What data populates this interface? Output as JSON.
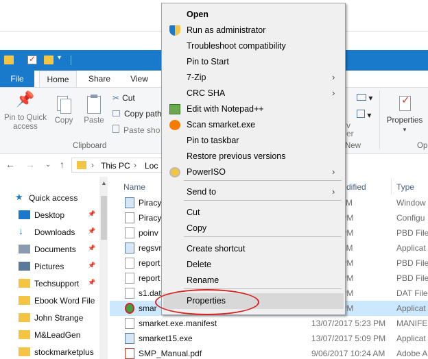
{
  "ribbon": {
    "tabs": {
      "file": "File",
      "home": "Home",
      "share": "Share",
      "view": "View"
    },
    "clipboard": {
      "pin_quick_access": "Pin to Quick access",
      "copy": "Copy",
      "paste": "Paste",
      "cut": "Cut",
      "copy_path": "Copy path",
      "paste_shortcut": "Paste sho",
      "group_label": "Clipboard"
    },
    "right": {
      "v": "v",
      "er": "er",
      "new_group": "New",
      "properties": "Properties",
      "op": "Op"
    }
  },
  "address": {
    "this_pc": "This PC",
    "loc": "Loc",
    "separator": "›"
  },
  "nav_pane": {
    "quick_access": "Quick access",
    "items": [
      {
        "label": "Desktop",
        "icon": "desktop-icon",
        "pinned": true
      },
      {
        "label": "Downloads",
        "icon": "downloads-icon",
        "pinned": true
      },
      {
        "label": "Documents",
        "icon": "documents-icon",
        "pinned": true
      },
      {
        "label": "Pictures",
        "icon": "pictures-icon",
        "pinned": true
      },
      {
        "label": "Techsupport",
        "icon": "folder-icon",
        "pinned": true
      },
      {
        "label": "Ebook Word File",
        "icon": "folder-icon",
        "pinned": false
      },
      {
        "label": "John Strange",
        "icon": "folder-icon",
        "pinned": false
      },
      {
        "label": "M&LeadGen",
        "icon": "folder-icon",
        "pinned": false
      },
      {
        "label": "stockmarketplus",
        "icon": "folder-icon",
        "pinned": false
      }
    ]
  },
  "file_list": {
    "columns": {
      "name": "Name",
      "date": "dified",
      "type": "Type"
    },
    "rows": [
      {
        "name": "Piracy",
        "date": "8 11:09 AM",
        "type": "Window",
        "icon": "exe-icon"
      },
      {
        "name": "Piracy",
        "date": "17 3:12 PM",
        "type": "Configu",
        "icon": "config-icon"
      },
      {
        "name": "poinv",
        "date": "17 5:09 PM",
        "type": "PBD File",
        "icon": "file-icon"
      },
      {
        "name": "regsvr",
        "date": "4 11:56 PM",
        "type": "Applicat",
        "icon": "exe-icon"
      },
      {
        "name": "report",
        "date": "17 5:09 PM",
        "type": "PBD File",
        "icon": "file-icon"
      },
      {
        "name": "report",
        "date": "17 5:09 PM",
        "type": "PBD File",
        "icon": "file-icon"
      },
      {
        "name": "s1.dat",
        "date": "17 5:09 PM",
        "type": "DAT File",
        "icon": "file-icon"
      },
      {
        "name": "smar",
        "date": "16 2:47 PM",
        "type": "Applicat",
        "icon": "smarket-icon",
        "selected": true
      },
      {
        "name": "smarket.exe.manifest",
        "date": "13/07/2017 5:23 PM",
        "type": "MANIFE",
        "icon": "file-icon"
      },
      {
        "name": "smarket15.exe",
        "date": "13/07/2017 5:09 PM",
        "type": "Applicat",
        "icon": "exe-icon"
      },
      {
        "name": "SMP_Manual.pdf",
        "date": "9/06/2017 10:24 AM",
        "type": "Adobe A",
        "icon": "pdf-icon"
      }
    ]
  },
  "context_menu": {
    "items": [
      {
        "label": "Open",
        "bold": true
      },
      {
        "label": "Run as administrator",
        "icon": "shield-icon"
      },
      {
        "label": "Troubleshoot compatibility"
      },
      {
        "label": "Pin to Start"
      },
      {
        "label": "7-Zip",
        "submenu": true
      },
      {
        "label": "CRC SHA",
        "submenu": true
      },
      {
        "label": "Edit with Notepad++",
        "icon": "notepad-icon"
      },
      {
        "label": "Scan smarket.exe",
        "icon": "avast-icon"
      },
      {
        "label": "Pin to taskbar"
      },
      {
        "label": "Restore previous versions"
      },
      {
        "label": "PowerISO",
        "icon": "poweriso-icon",
        "submenu": true
      },
      {
        "label": "Send to",
        "submenu": true
      },
      {
        "label": "Cut"
      },
      {
        "label": "Copy"
      },
      {
        "label": "Create shortcut"
      },
      {
        "label": "Delete"
      },
      {
        "label": "Rename"
      },
      {
        "label": "Properties",
        "highlighted": true
      }
    ],
    "arrow_glyph": "›"
  },
  "colors": {
    "accent": "#1979ca",
    "selection": "#cce8ff",
    "annotation": "#d9201e"
  }
}
